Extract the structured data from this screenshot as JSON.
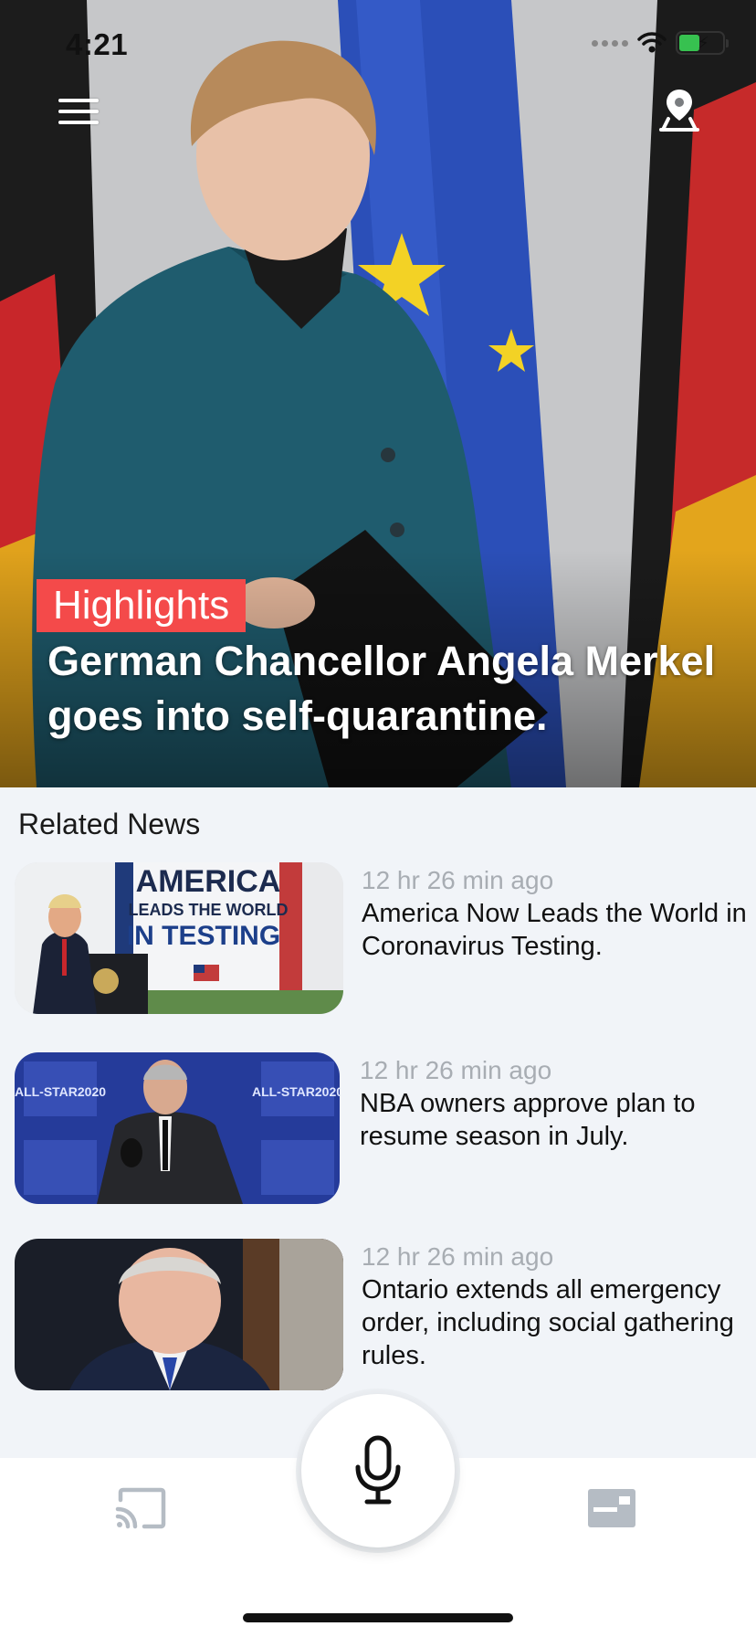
{
  "status_bar": {
    "time": "4:21"
  },
  "hero": {
    "tag": "Highlights",
    "title": "German Chancellor Angela Merkel goes into self-quarantine."
  },
  "related": {
    "heading": "Related News",
    "items": [
      {
        "time": "12 hr 26 min ago",
        "title": "America Now Leads the World in Coronavirus Testing.",
        "thumb_text": [
          "AMERICA",
          "LEADS THE WORLD",
          "IN TESTING"
        ]
      },
      {
        "time": "12 hr 26 min ago",
        "title": "NBA owners approve plan to resume season in July.",
        "thumb_text": [
          "ALL-STAR2020"
        ]
      },
      {
        "time": "12 hr 26 min ago",
        "title": "Ontario extends all emergency order, including social gathering rules.",
        "thumb_text": []
      }
    ]
  },
  "icons": {
    "menu": "hamburger-menu-icon",
    "location": "map-pin-icon",
    "cast": "cast-icon",
    "mic": "microphone-icon",
    "news": "news-card-icon"
  },
  "colors": {
    "highlight_tag": "#f44a4a",
    "time_text": "#a8adb3",
    "battery": "#37c150"
  }
}
